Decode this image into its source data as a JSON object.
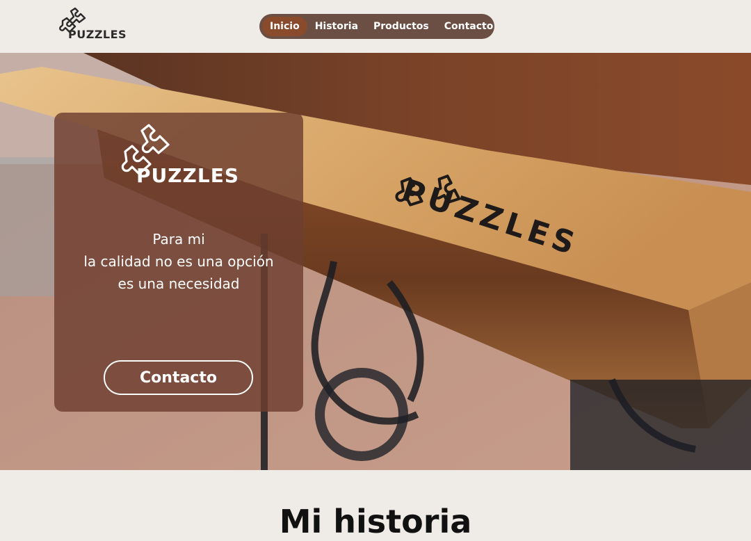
{
  "brand": {
    "name": "PUZZLES",
    "burned_text": "PUZZLES"
  },
  "nav": {
    "items": [
      {
        "label": "Inicio",
        "active": true
      },
      {
        "label": "Historia",
        "active": false
      },
      {
        "label": "Productos",
        "active": false
      },
      {
        "label": "Contacto",
        "active": false
      }
    ]
  },
  "hero": {
    "tagline": [
      "Para mi",
      "la calidad no es una opción",
      "es una necesidad"
    ],
    "button_label": "Contacto"
  },
  "next_section": {
    "title": "Mi historia"
  },
  "colors": {
    "background": "#efebe6",
    "nav_bg": "#6b4f44",
    "nav_active": "#8a4a2c",
    "card_bg": "#6e3e30",
    "wood_top": "#d9a86a",
    "wood_dark": "#6a3a20"
  },
  "icons": {
    "logo": "puzzle-pieces-icon"
  }
}
